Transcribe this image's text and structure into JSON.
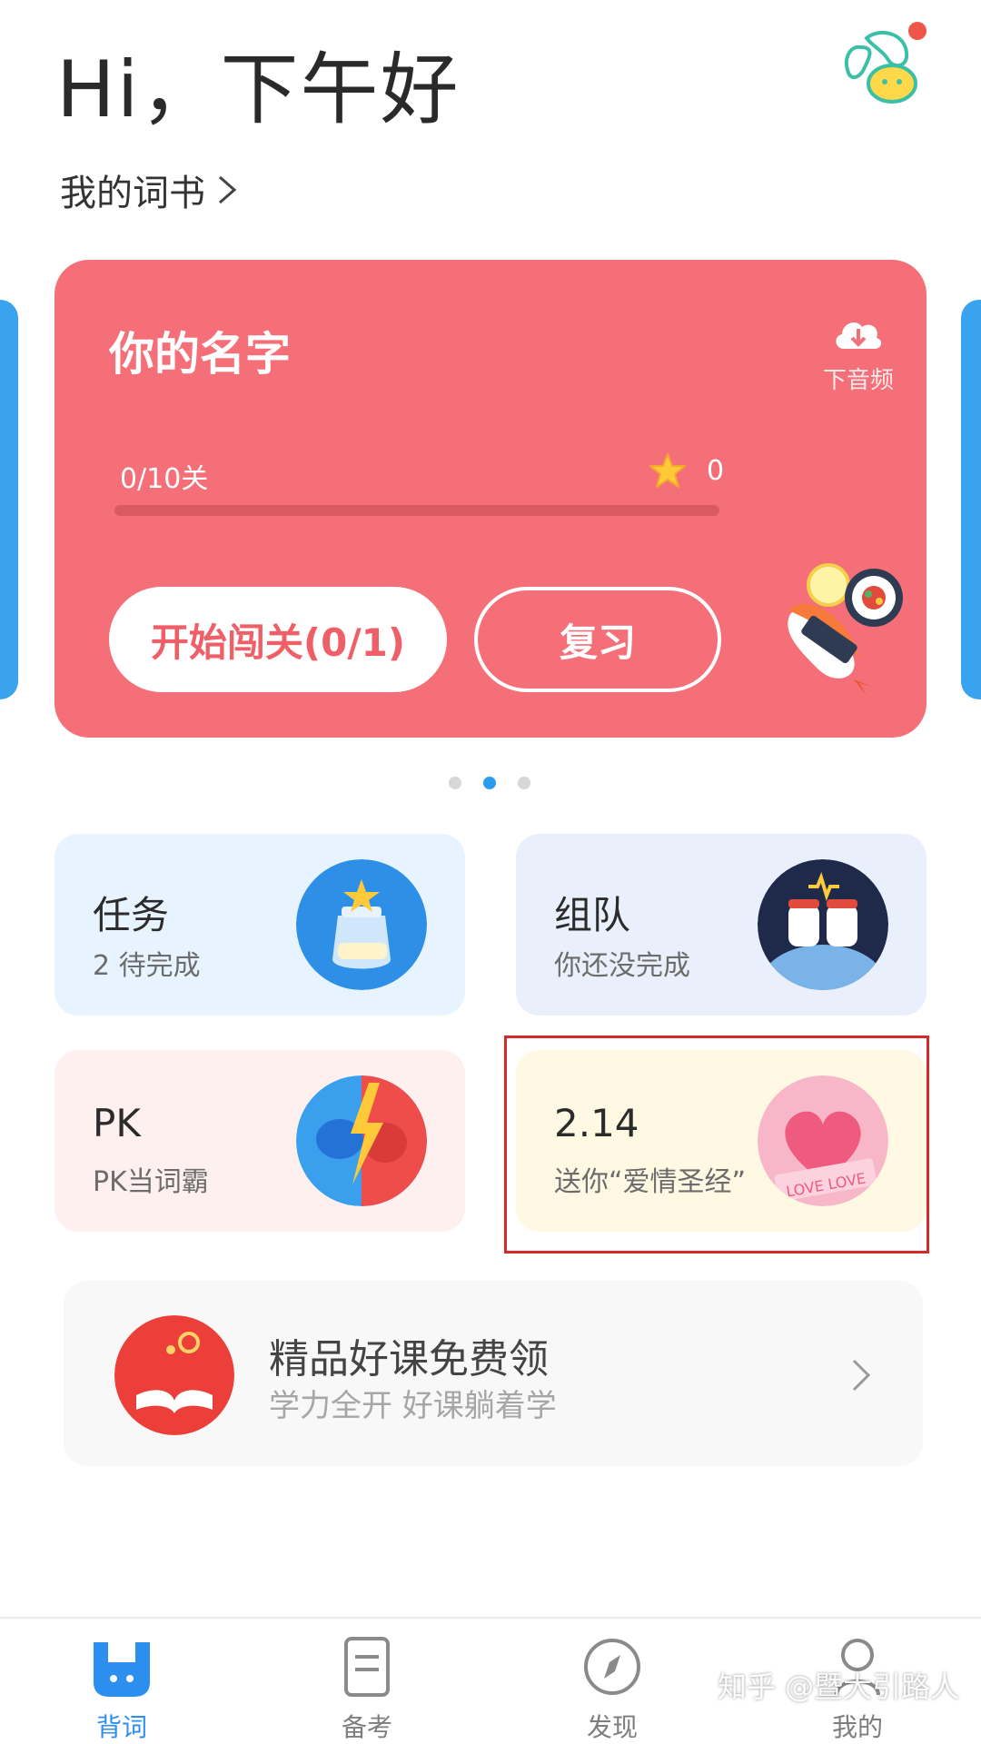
{
  "header": {
    "greeting": "Hi，下午好",
    "avatar_icon": "bean-mascot-icon",
    "notification_color": "#ef5548"
  },
  "wordbook": {
    "label": "我的词书"
  },
  "book_card": {
    "title": "你的名字",
    "download_label": "下音频",
    "progress_text": "0/10关",
    "progress_fraction": 0,
    "stars": "0",
    "start_button": "开始闯关(0/1)",
    "review_button": "复习",
    "background_color": "#f56f78"
  },
  "carousel": {
    "count": 3,
    "active_index": 1
  },
  "tiles": {
    "task": {
      "title": "任务",
      "subtitle": "2 待完成"
    },
    "team": {
      "title": "组队",
      "subtitle": "你还没完成"
    },
    "pk": {
      "title": "PK",
      "subtitle": "PK当词霸"
    },
    "valentine": {
      "title": "2.14",
      "subtitle": "送你“爱情圣经”"
    }
  },
  "course": {
    "title": "精品好课免费领",
    "subtitle": "学力全开 好课躺着学"
  },
  "tabbar": {
    "tabs": [
      {
        "label": "背词",
        "icon": "bunny-icon",
        "active": true
      },
      {
        "label": "备考",
        "icon": "document-icon",
        "active": false
      },
      {
        "label": "发现",
        "icon": "compass-icon",
        "active": false
      },
      {
        "label": "我的",
        "icon": "person-icon",
        "active": false
      }
    ],
    "active_color": "#2c8ff0"
  },
  "watermark": "知乎 @暨大引路人"
}
